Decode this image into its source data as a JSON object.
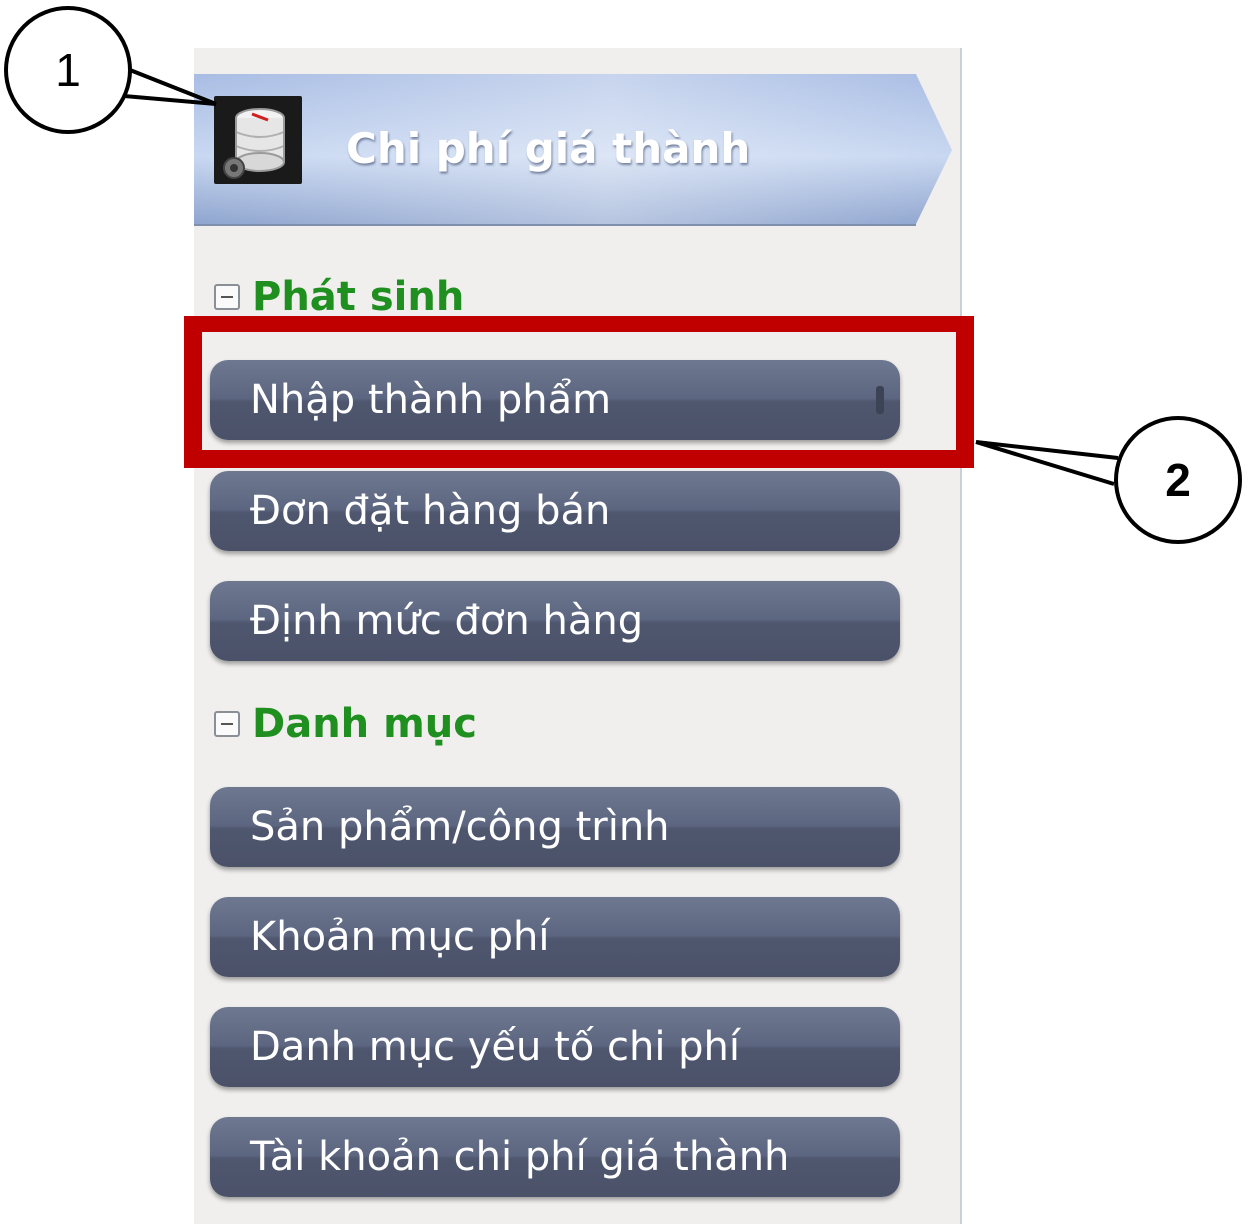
{
  "header": {
    "title": "Chi phí giá thành",
    "icon": "database-settings-icon"
  },
  "groups": [
    {
      "label": "Phát sinh",
      "items": [
        "Nhập thành phẩm",
        "Đơn đặt hàng bán",
        "Định mức đơn hàng"
      ]
    },
    {
      "label": "Danh mục",
      "items": [
        "Sản phẩm/công trình",
        "Khoản mục phí",
        "Danh mục yếu tố chi phí",
        "Tài khoản chi phí giá thành"
      ]
    }
  ],
  "callouts": [
    "1",
    "2"
  ],
  "colors": {
    "highlight": "#c00000",
    "group_label": "#1f8f1f",
    "item_bg": "#5d6680"
  }
}
